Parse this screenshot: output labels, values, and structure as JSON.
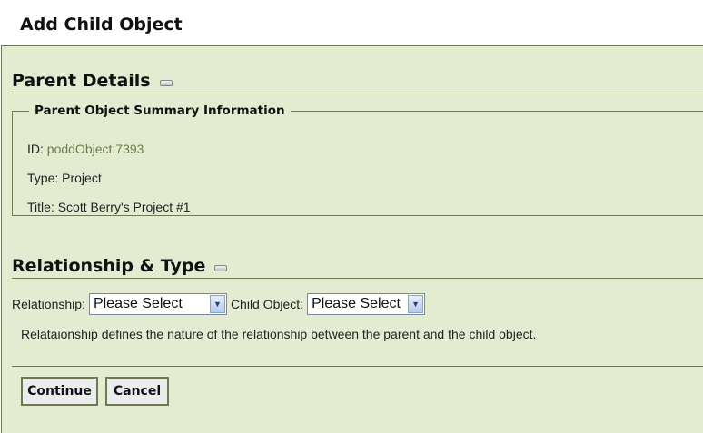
{
  "page": {
    "title": "Add Child Object"
  },
  "parent_details": {
    "heading": "Parent Details",
    "summary": {
      "legend": "Parent Object Summary Information",
      "id_label": "ID:",
      "id_value": "poddObject:7393",
      "type_label": "Type:",
      "type_value": "Project",
      "title_label": "Title:",
      "title_value": "Scott Berry's Project #1"
    }
  },
  "relationship": {
    "heading": "Relationship & Type",
    "relationship_label": "Relationship:",
    "relationship_selected": "Please Select",
    "child_object_label": "Child Object:",
    "child_object_selected": "Please Select",
    "help_text": "Relataionship defines the nature of the relationship between the parent and the child object."
  },
  "actions": {
    "continue_label": "Continue",
    "cancel_label": "Cancel"
  },
  "icons": {
    "collapse": "collapse-icon",
    "dropdown": "chevron-down-icon"
  },
  "colors": {
    "panel_background": "#e3ecd0",
    "border_green": "#6b7d4f",
    "id_value": "#6b7d4f"
  }
}
